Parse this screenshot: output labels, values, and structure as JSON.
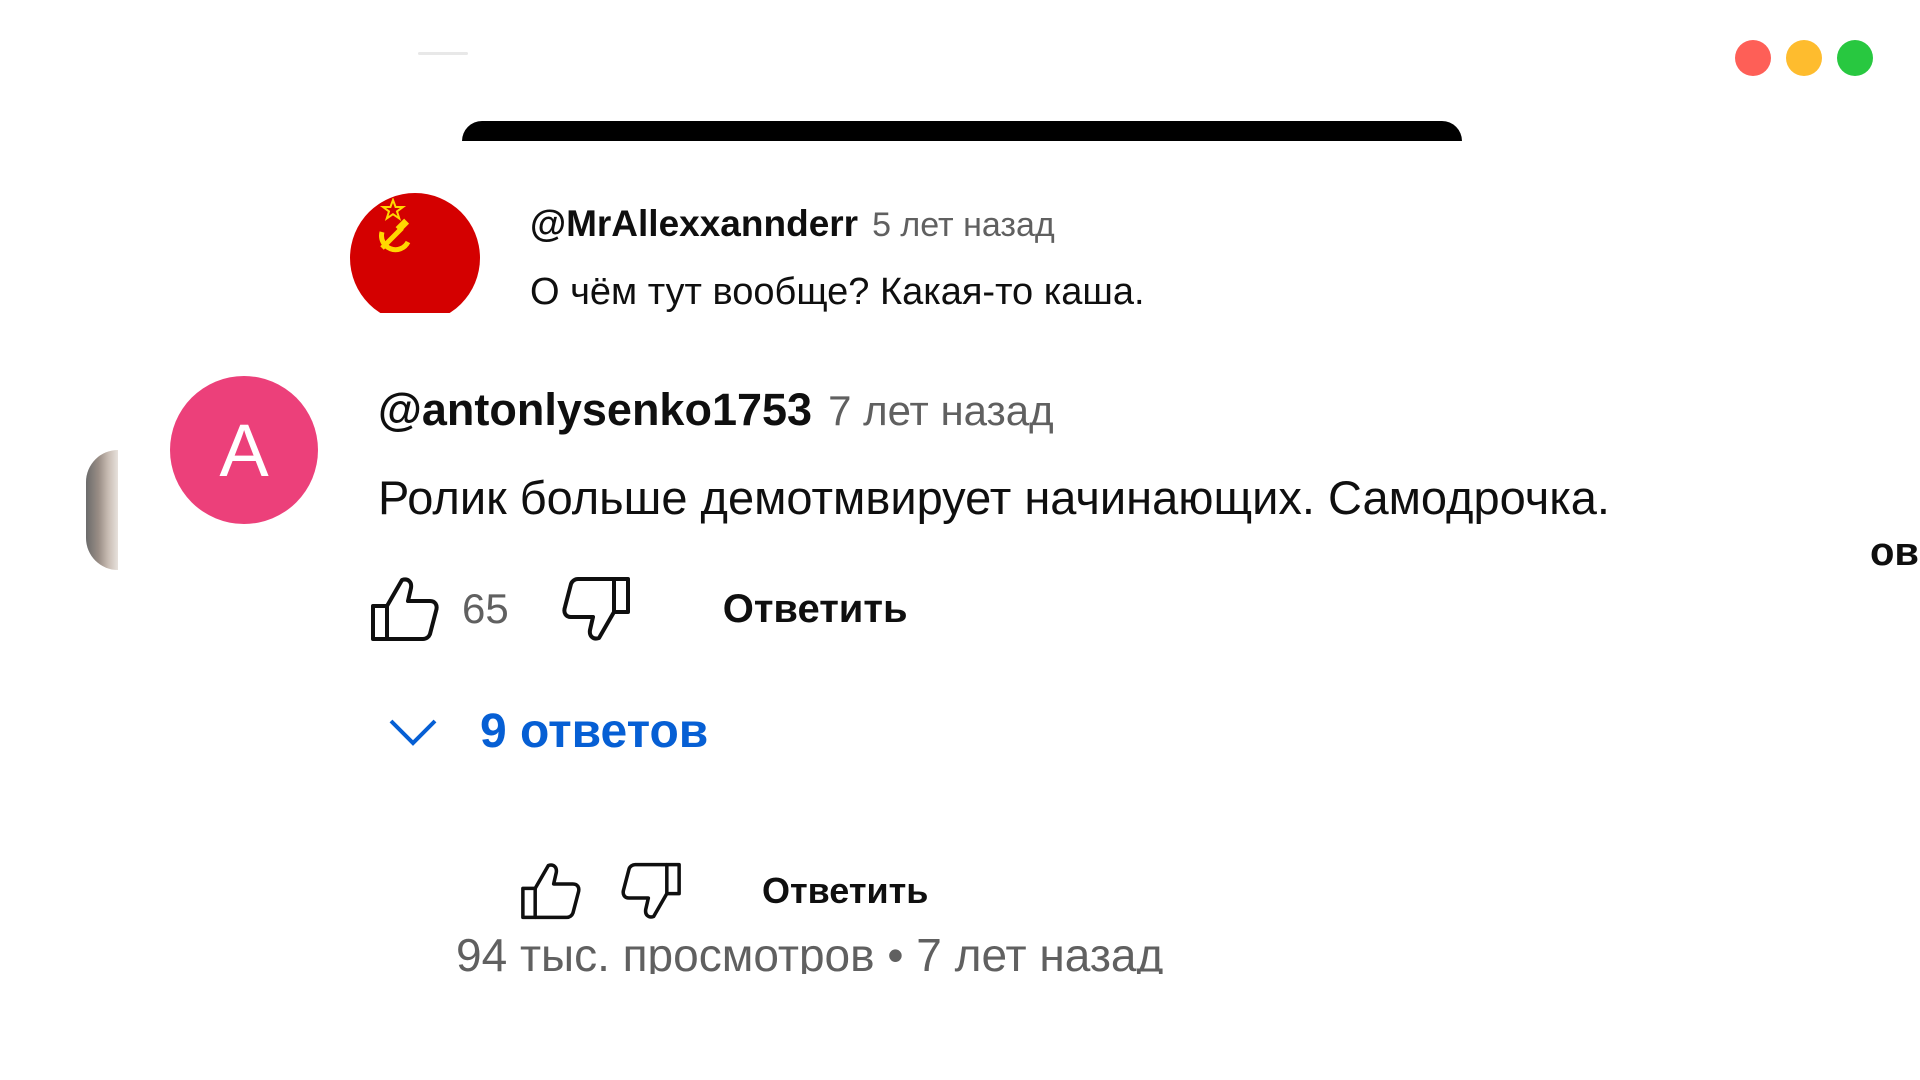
{
  "window": {
    "dots": [
      {
        "name": "close",
        "color": "#fe5f57"
      },
      {
        "name": "minimize",
        "color": "#febc2e"
      },
      {
        "name": "maximize",
        "color": "#28c840"
      }
    ]
  },
  "edge_fragment": "ов.",
  "top_comment": {
    "avatar_icon": "hammer-sickle-flag-icon",
    "username": "@MrAllexxannderr",
    "time": "5 лет назад",
    "text": "О чём тут вообще? Какая-то каша."
  },
  "main_comment": {
    "avatar_letter": "A",
    "avatar_color": "#ec407a",
    "username": "@antonlysenko1753",
    "time": "7 лет назад",
    "text": "Ролик больше демотмвирует начинающих. Самодрочка.",
    "likes": "65",
    "reply_label": "Ответить",
    "replies_label": "9 ответов"
  },
  "bottom_actions": {
    "reply_label": "Ответить"
  },
  "video_meta": {
    "text": "94 тыс. просмотров • 7 лет назад"
  },
  "colors": {
    "link_blue": "#065fd4",
    "secondary_text": "#606060"
  }
}
